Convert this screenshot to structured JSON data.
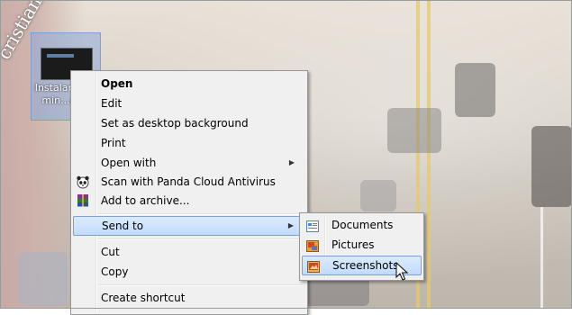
{
  "watermark": "cristianls.ro",
  "desktop_icon": {
    "name": "Instalare-ualmin...ntCl"
  },
  "context_menu": {
    "items": [
      {
        "label": "Open"
      },
      {
        "label": "Edit"
      },
      {
        "label": "Set as desktop background"
      },
      {
        "label": "Print"
      },
      {
        "label": "Open with"
      },
      {
        "label": "Scan with Panda Cloud Antivirus",
        "icon": "panda-icon"
      },
      {
        "label": "Add to archive...",
        "icon": "winrar-icon"
      },
      {
        "label": "Send to"
      },
      {
        "label": "Cut"
      },
      {
        "label": "Copy"
      },
      {
        "label": "Create shortcut"
      }
    ]
  },
  "send_to_menu": {
    "items": [
      {
        "label": "Documents",
        "icon": "documents-library-icon"
      },
      {
        "label": "Pictures",
        "icon": "pictures-library-icon"
      },
      {
        "label": "Screenshots",
        "icon": "screenshots-folder-icon"
      }
    ]
  },
  "colors": {
    "highlight": "#c1dbfc",
    "menu_bg": "#f0f0f0"
  }
}
